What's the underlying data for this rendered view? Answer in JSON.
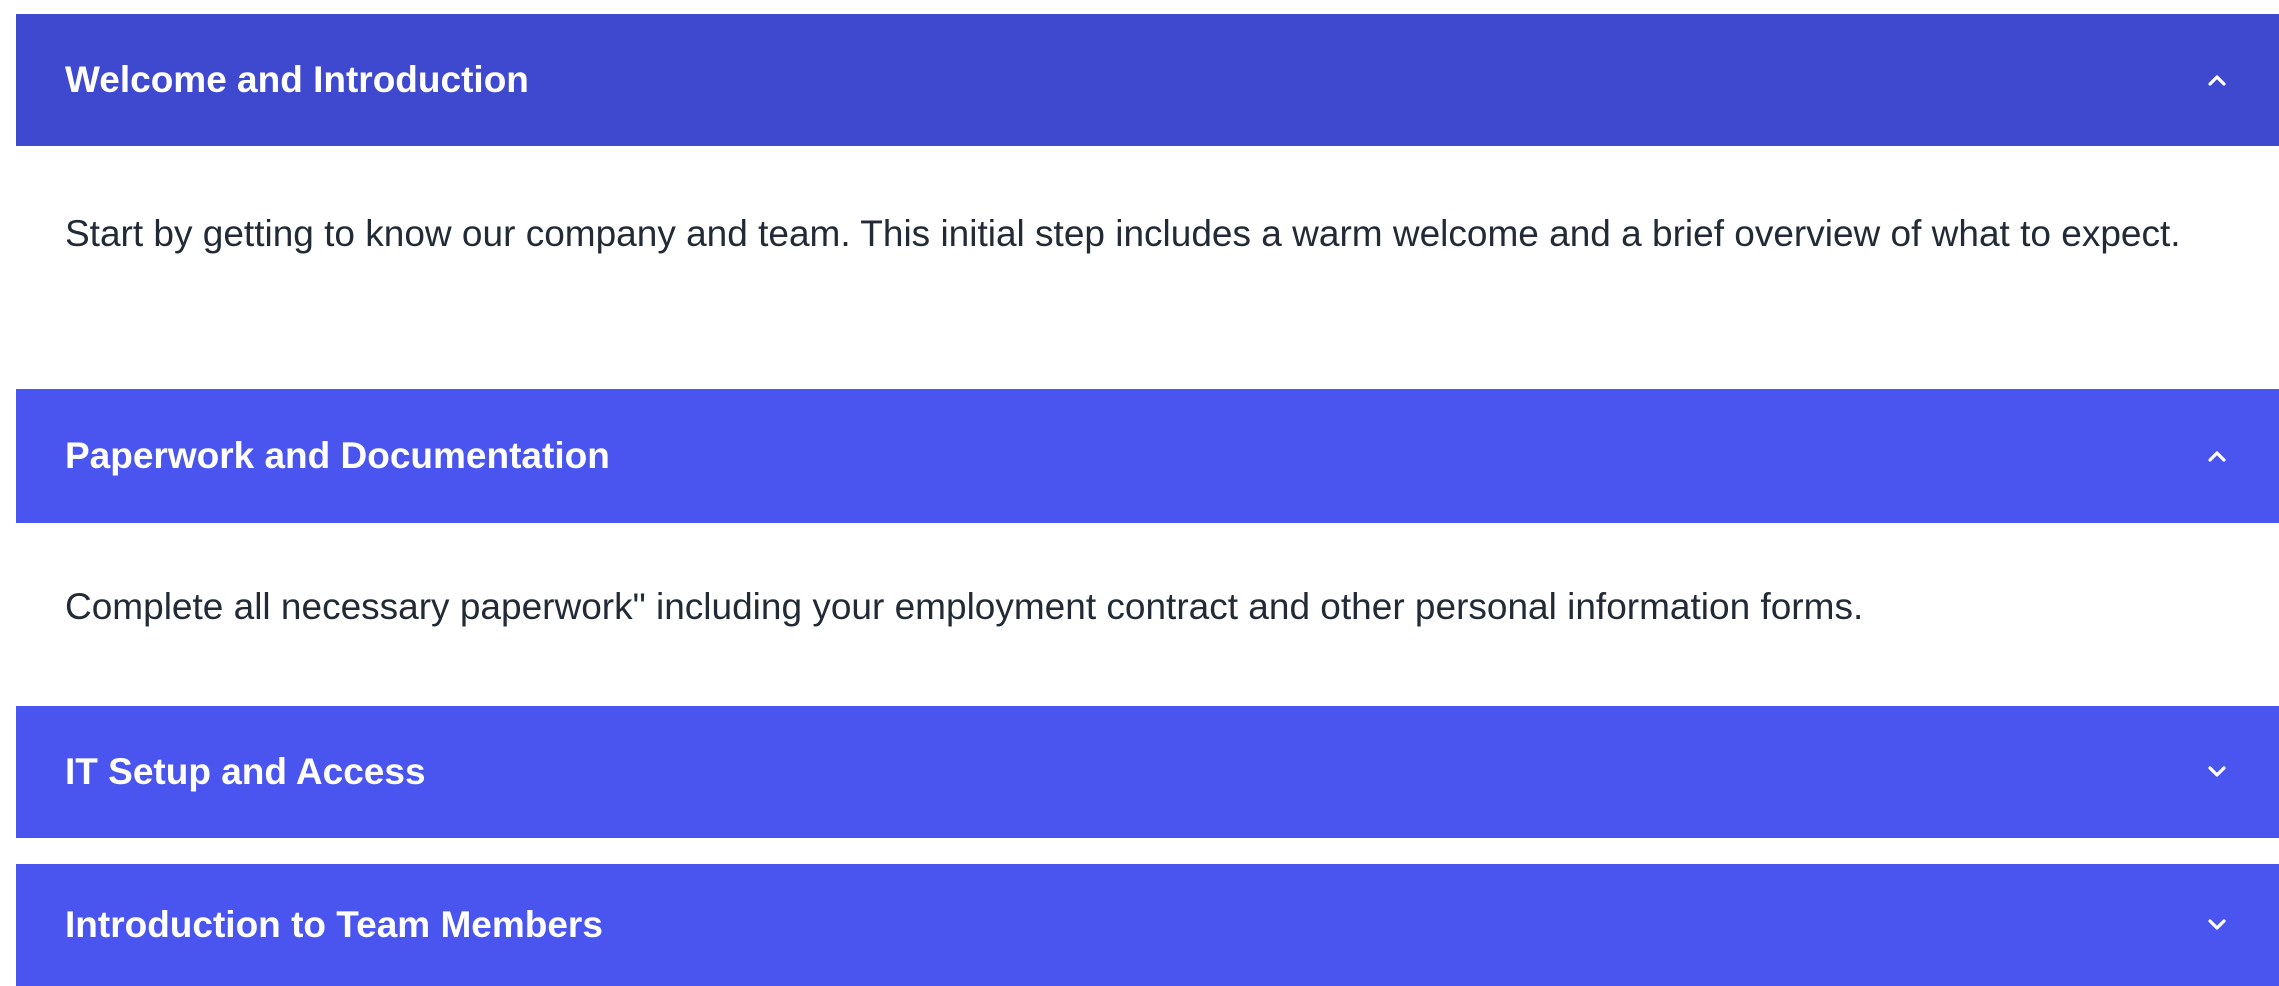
{
  "colors": {
    "header_first": "#3f49cf",
    "header": "#4a55f0",
    "body_text": "#222a36",
    "header_text": "#ffffff"
  },
  "accordion": {
    "items": [
      {
        "title": "Welcome and Introduction",
        "expanded": true,
        "chevron_icon": "chevron-up-icon",
        "body": "Start by getting to know our company and team. This initial step includes a warm welcome and a brief overview of what to expect."
      },
      {
        "title": "Paperwork and Documentation",
        "expanded": true,
        "chevron_icon": "chevron-up-icon",
        "body": "Complete all necessary paperwork\" including your employment contract and other personal information forms."
      },
      {
        "title": "IT Setup and Access",
        "expanded": false,
        "chevron_icon": "chevron-down-icon"
      },
      {
        "title": "Introduction to Team Members",
        "expanded": false,
        "chevron_icon": "chevron-down-icon"
      }
    ]
  }
}
